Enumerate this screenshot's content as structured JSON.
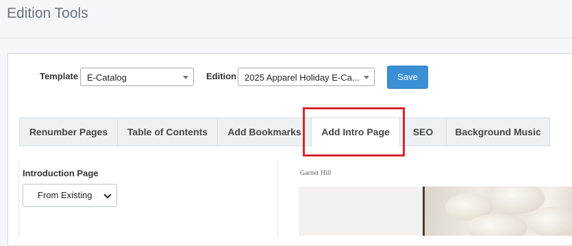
{
  "page": {
    "title": "Edition Tools"
  },
  "form": {
    "template_label": "Template",
    "template_value": "E-Catalog",
    "edition_label": "Edition",
    "edition_value": "2025 Apparel Holiday E-Ca...",
    "save_label": "Save"
  },
  "tabs": [
    {
      "label": "Renumber Pages",
      "active": false
    },
    {
      "label": "Table of Contents",
      "active": false
    },
    {
      "label": "Add Bookmarks",
      "active": false
    },
    {
      "label": "Add Intro Page",
      "active": true
    },
    {
      "label": "SEO",
      "active": false
    },
    {
      "label": "Background Music",
      "active": false
    }
  ],
  "intro": {
    "label": "Introduction Page",
    "select_value": "From Existing"
  },
  "preview": {
    "brand": "Garnet Hill"
  },
  "colors": {
    "accent": "#3a8fd5",
    "highlight": "#d4242b"
  }
}
